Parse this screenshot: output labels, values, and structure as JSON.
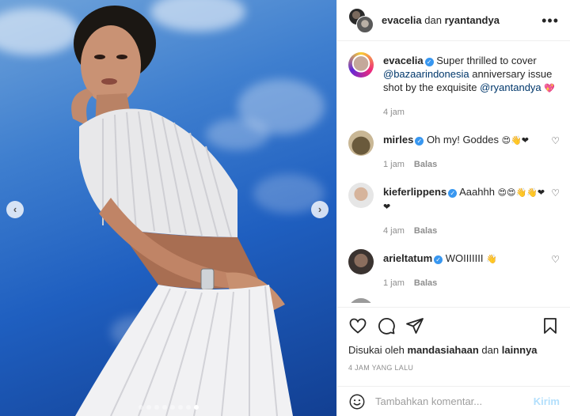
{
  "header": {
    "user1": "evacelia",
    "joiner": "dan",
    "user2": "ryantandya",
    "more_icon": "more-horizontal-icon"
  },
  "caption": {
    "user": "evacelia",
    "text_before": "Super thrilled to cover ",
    "mention1": "@bazaarindonesia",
    "text_mid": " anniversary issue shot by the exquisite ",
    "mention2": "@ryantandya",
    "emoji": "💖",
    "time": "4 jam"
  },
  "comments": [
    {
      "user": "mirles",
      "verified": true,
      "text": "Oh my! Goddes",
      "emoji": "😍👋❤",
      "time": "1 jam",
      "reply": "Balas"
    },
    {
      "user": "kieferlippens",
      "verified": true,
      "text": "Aaahhh",
      "emoji": "😍😍👋👋❤❤",
      "time": "4 jam",
      "reply": "Balas"
    },
    {
      "user": "arieltatum",
      "verified": true,
      "text": "WOIIIIIII",
      "emoji": "👋",
      "time": "1 jam",
      "reply": "Balas"
    }
  ],
  "actions": {
    "like_icon": "heart-icon",
    "comment_icon": "comment-icon",
    "share_icon": "paper-plane-icon",
    "save_icon": "bookmark-icon"
  },
  "likes": {
    "prefix": "Disukai oleh",
    "user": "mandasiahaan",
    "joiner": "dan",
    "others": "lainnya"
  },
  "timestamp": "4 JAM YANG LALU",
  "composer": {
    "placeholder": "Tambahkan komentar...",
    "post_label": "Kirim"
  },
  "carousel": {
    "total": 8,
    "active": 7
  },
  "colors": {
    "mention": "#00376b",
    "verified": "#3897f0",
    "post_disabled": "#b2dffc",
    "meta": "#8e8e8e"
  }
}
